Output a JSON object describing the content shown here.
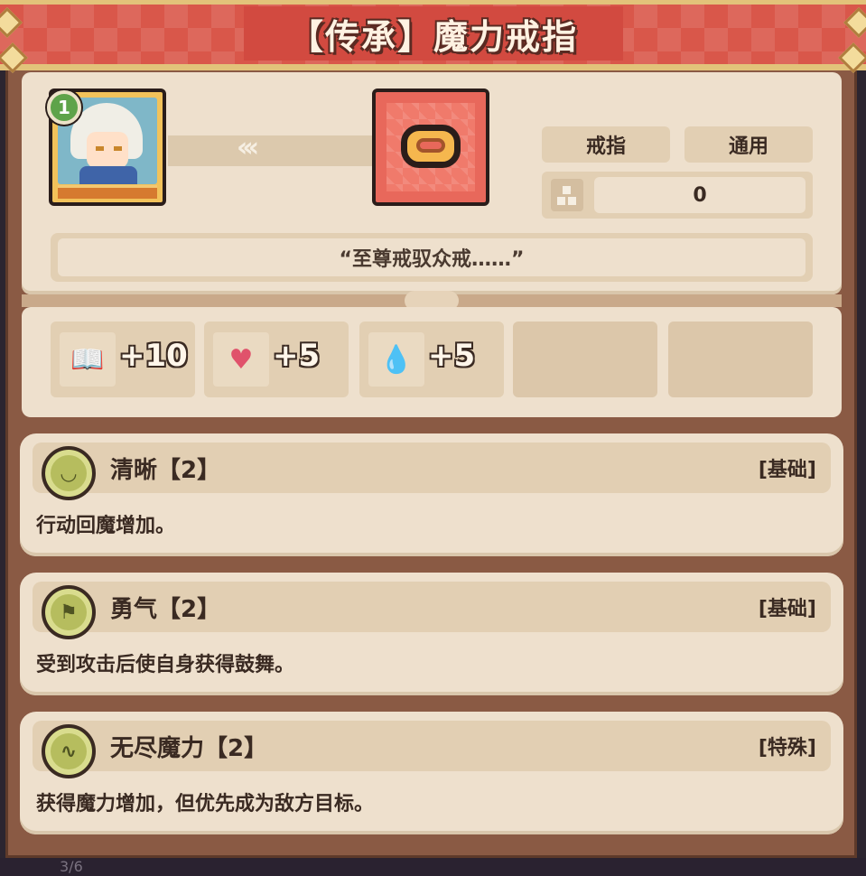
{
  "header": {
    "title": "【传承】魔力戒指"
  },
  "character": {
    "level": "1",
    "icon": "character-portrait-icon"
  },
  "item": {
    "icon": "ring-icon",
    "type_label": "戒指",
    "scope_label": "通用",
    "count_icon": "grid-icon",
    "count_value": "0",
    "quote": "“至尊戒驭众戒……”"
  },
  "stats": [
    {
      "icon": "book-icon",
      "glyph": "📖",
      "value": "+10"
    },
    {
      "icon": "heart-icon",
      "glyph": "♥",
      "value": "+5"
    },
    {
      "icon": "water-drop-icon",
      "glyph": "💧",
      "value": "+5"
    }
  ],
  "traits": [
    {
      "icon": "clarity-medal-icon",
      "name": "清晰【2】",
      "category": "[基础]",
      "description": "行动回魔增加。"
    },
    {
      "icon": "courage-medal-icon",
      "name": "勇气【2】",
      "category": "[基础]",
      "description": "受到攻击后使自身获得鼓舞。"
    },
    {
      "icon": "endless-magic-medal-icon",
      "name": "无尽魔力【2】",
      "category": "[特殊]",
      "description": "获得魔力增加，但优先成为敌方目标。"
    }
  ],
  "footer": {
    "page_indicator": "3/6"
  },
  "colors": {
    "header_red": "#d9574a",
    "panel_cream": "#eee0cd",
    "frame_brown": "#8a5a44",
    "accent_gold": "#e2c37a"
  }
}
